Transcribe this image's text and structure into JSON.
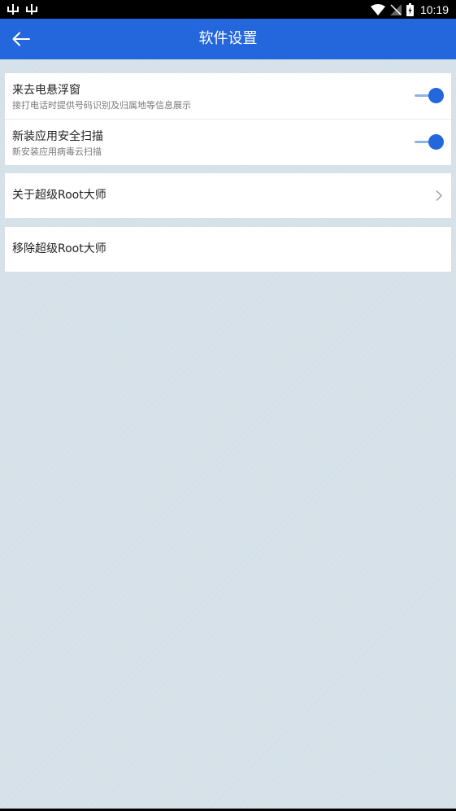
{
  "status_bar": {
    "time": "10:19",
    "left_icons": [
      "android-debug-icon",
      "android-debug-icon"
    ],
    "right_icons": [
      "wifi-icon",
      "no-signal-icon",
      "battery-charging-icon"
    ]
  },
  "app_bar": {
    "title": "软件设置",
    "back_icon": "arrow-left-icon",
    "color": "#2467dc"
  },
  "settings": {
    "floating_window": {
      "title": "来去电悬浮窗",
      "subtitle": "接打电话时提供号码识别及归属地等信息展示",
      "enabled": true
    },
    "install_scan": {
      "title": "新装应用安全扫描",
      "subtitle": "新安装应用病毒云扫描",
      "enabled": true
    },
    "about": {
      "label": "关于超级Root大师",
      "icon": "chevron-right-icon"
    },
    "remove": {
      "label": "移除超级Root大师"
    }
  },
  "colors": {
    "accent": "#2467dc",
    "toggle_track": "#8fb1ea",
    "background": "#d3dfe7"
  }
}
